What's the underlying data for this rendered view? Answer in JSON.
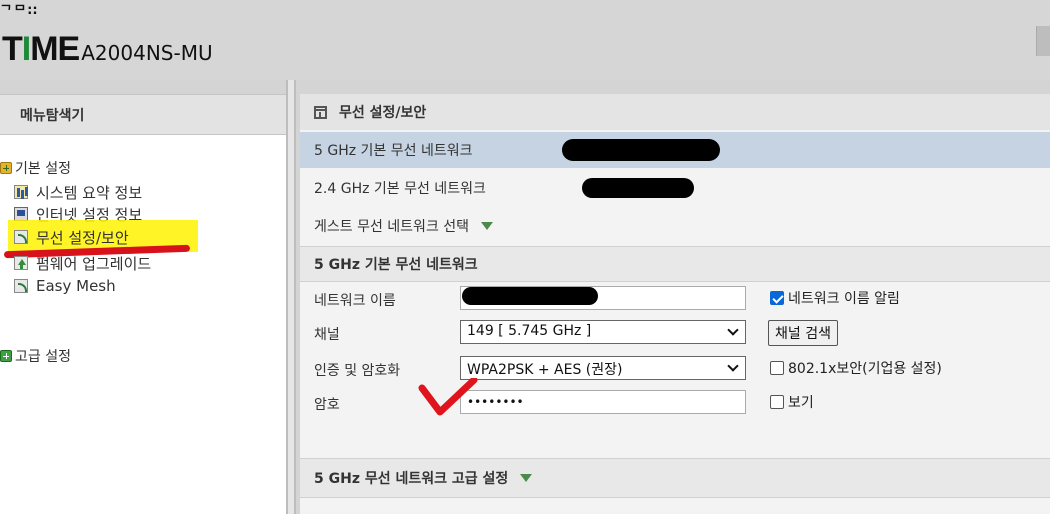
{
  "header": {
    "brand_small": "ᄀᄆ∷",
    "logo_prefix": "T",
    "logo_accent": "I",
    "logo_suffix": "ME",
    "model": "A2004NS-MU"
  },
  "sidebar": {
    "title": "메뉴탐색기",
    "groups": [
      {
        "label": "기본 설정",
        "items": [
          {
            "label": "시스템 요약 정보",
            "icon": "bar-chart-icon"
          },
          {
            "label": "인터넷 설정 정보",
            "icon": "monitor-icon"
          },
          {
            "label": "무선 설정/보안",
            "icon": "wireless-icon",
            "selected": true
          },
          {
            "label": "펌웨어 업그레이드",
            "icon": "upload-arrow-icon"
          },
          {
            "label": "Easy Mesh",
            "icon": "wireless-icon"
          }
        ]
      },
      {
        "label": "고급 설정",
        "items": []
      }
    ]
  },
  "main": {
    "title": "무선 설정/보안",
    "net5_label": "5 GHz 기본 무선 네트워크",
    "net24_label": "2.4 GHz 기본 무선 네트워크",
    "guest_label": "게스트 무선 네트워크 선택",
    "section_title": "5 GHz 기본 무선 네트워크",
    "fields": {
      "network_name_label": "네트워크 이름",
      "network_name_checkbox": "네트워크 이름 알림",
      "network_name_checked": true,
      "channel_label": "채널",
      "channel_value": "149 [ 5.745 GHz ]",
      "channel_scan_button": "채널 검색",
      "auth_label": "인증 및 암호화",
      "auth_value": "WPA2PSK + AES (권장)",
      "enterprise_checkbox": "802.1x보안(기업용 설정)",
      "enterprise_checked": false,
      "password_label": "암호",
      "password_value": "••••••••",
      "show_checkbox": "보기",
      "show_checked": false
    },
    "advanced_title": "5 GHz 무선 네트워크 고급 설정"
  },
  "colors": {
    "highlight": "#fff200",
    "annotation_red": "#d8121b",
    "selected_row": "#c5d3e3",
    "accent_green": "#1f8a3a"
  }
}
